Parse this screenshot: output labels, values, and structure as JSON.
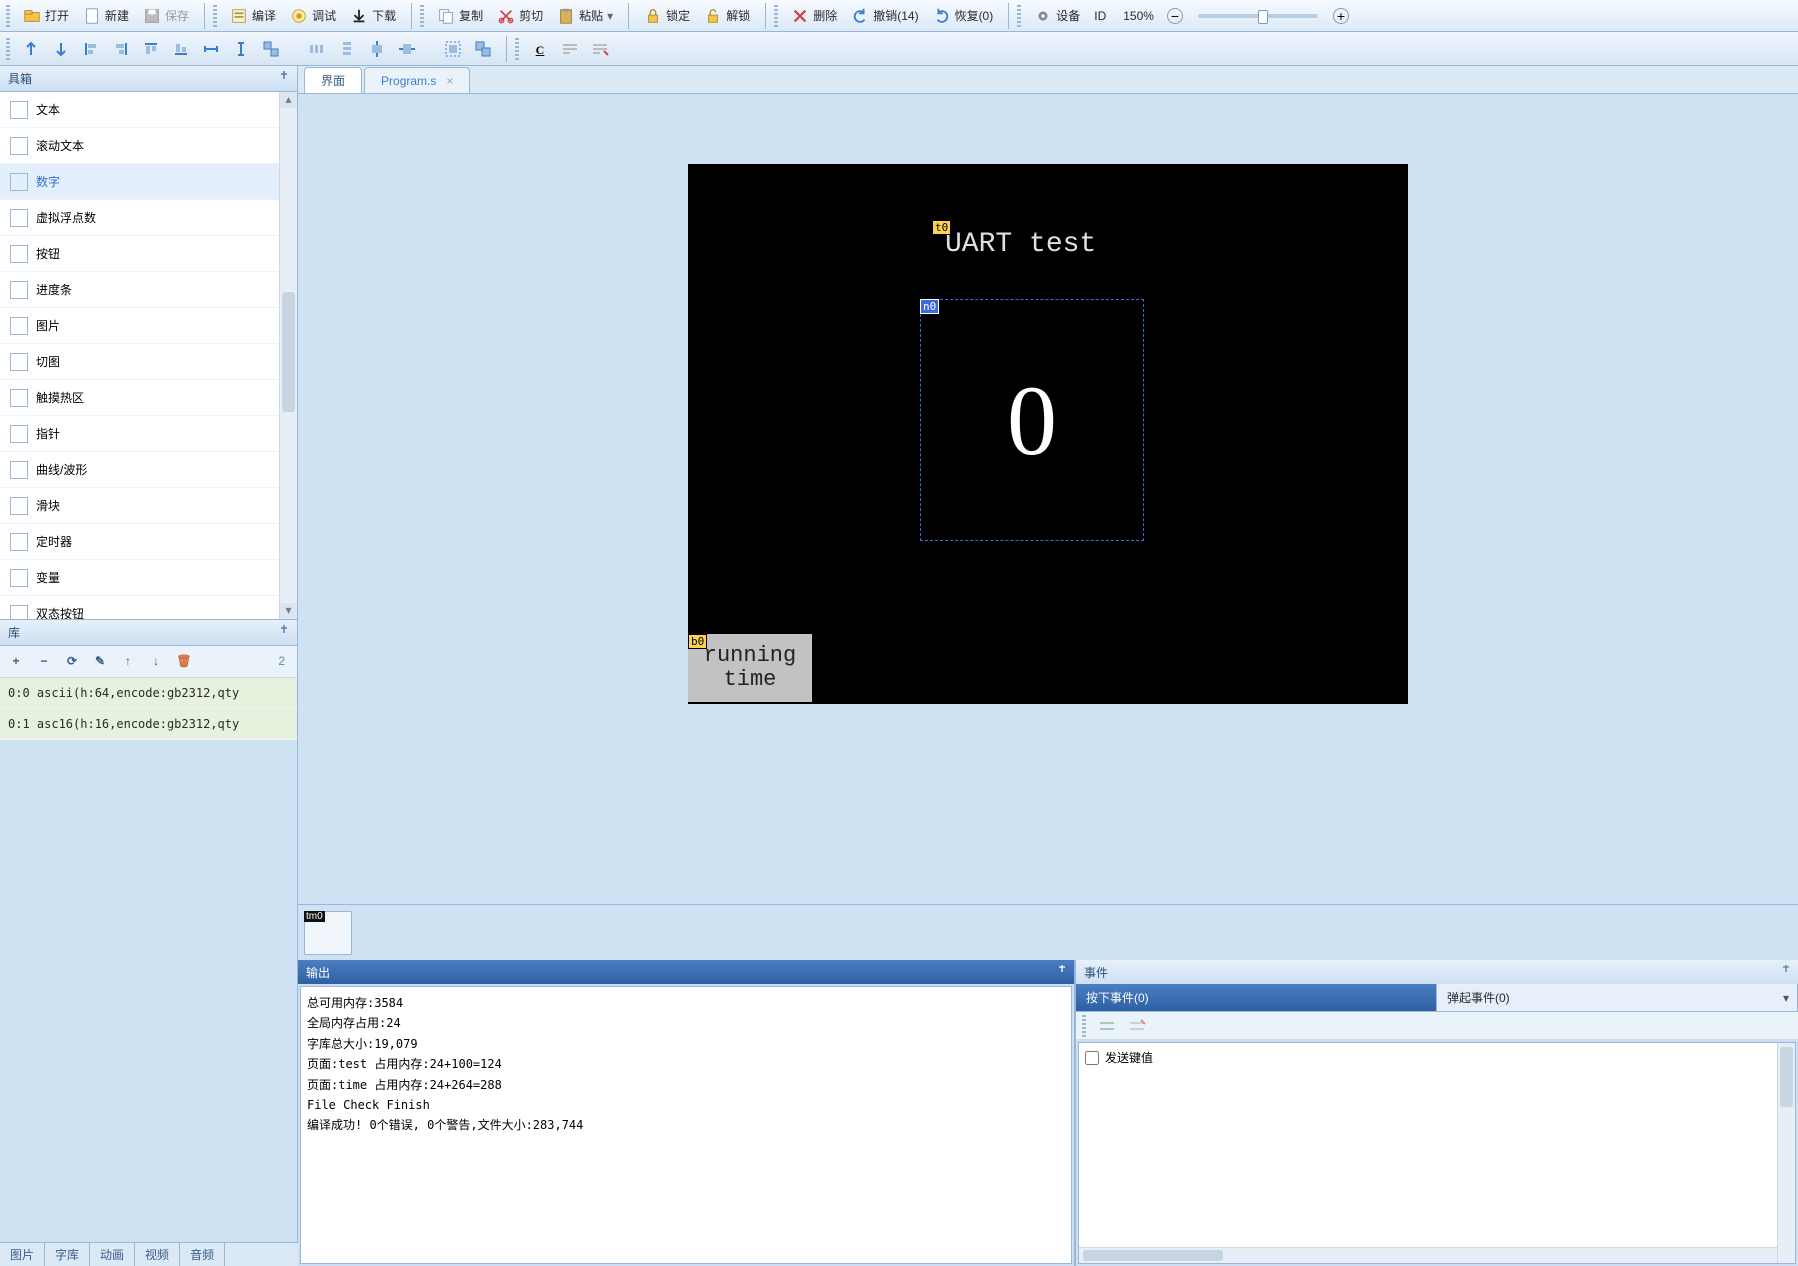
{
  "toolbar1": {
    "open": "打开",
    "new": "新建",
    "save": "保存",
    "compile": "编译",
    "debug": "调试",
    "download": "下载",
    "copy": "复制",
    "cut": "剪切",
    "paste": "粘贴",
    "lock": "锁定",
    "unlock": "解锁",
    "delete": "删除",
    "undo": "撤销(14)",
    "redo": "恢复(0)",
    "device": "设备",
    "id": "ID",
    "zoom": "150%"
  },
  "toolbar2": {
    "underline": "C"
  },
  "left": {
    "toolbox_title": "具箱",
    "items": [
      "文本",
      "滚动文本",
      "数字",
      "虚拟浮点数",
      "按钮",
      "进度条",
      "图片",
      "切图",
      "触摸热区",
      "指针",
      "曲线/波形",
      "滑块",
      "定时器",
      "变量",
      "双态按钮"
    ],
    "selected_index": 2,
    "lib_title": "库",
    "lib_tools": {
      "add": "+",
      "sub": "−",
      "refresh": "⟳",
      "edit": "✎",
      "up": "↑",
      "down": "↓",
      "del": "🗑"
    },
    "lib_count": "2",
    "lib_rows": [
      "0:0  ascii(h:64,encode:gb2312,qty",
      "0:1  asc16(h:16,encode:gb2312,qty"
    ]
  },
  "tabs": {
    "t0": "界面",
    "t1": "Program.s",
    "t1_close": "×"
  },
  "design": {
    "t0_tag": "t0",
    "t0_text": "UART test",
    "n0_tag": "n0",
    "n0_value": "0",
    "b0_tag": "b0",
    "b0_text": "running\ntime",
    "comp_tag": "tm0"
  },
  "output": {
    "title": "输出",
    "lines": [
      "总可用内存:3584",
      "全局内存占用:24",
      "字库总大小:19,079",
      "页面:test 占用内存:24+100=124",
      "页面:time 占用内存:24+264=288",
      "File Check Finish",
      "编译成功! 0个错误, 0个警告,文件大小:283,744"
    ]
  },
  "events": {
    "title": "事件",
    "press": "按下事件(0)",
    "release": "弹起事件(0)",
    "caret": "▾",
    "send_key": "发送键值"
  },
  "bottom_tabs": [
    "图片",
    "字库",
    "动画",
    "视频",
    "音频"
  ]
}
